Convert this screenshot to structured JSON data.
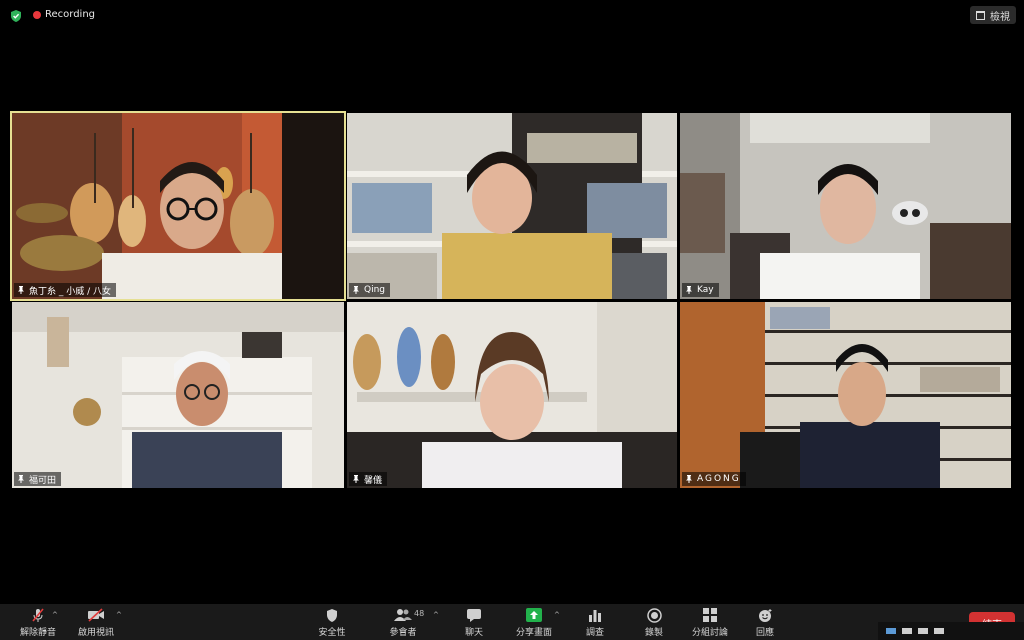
{
  "topbar": {
    "recording_label": "Recording",
    "view_label": "檢視"
  },
  "participants": [
    {
      "name": "魚丁糸 _ 小威 / 八女",
      "active": true
    },
    {
      "name": "Qing"
    },
    {
      "name": "Kay"
    },
    {
      "name": "福可田"
    },
    {
      "name": "馨儀"
    },
    {
      "name": "AGONG"
    }
  ],
  "toolbar": {
    "unmute_label": "解除靜音",
    "start_video_label": "啟用視訊",
    "security_label": "安全性",
    "participants_label": "參會者",
    "participants_count": "48",
    "chat_label": "聊天",
    "share_label": "分享畫面",
    "polls_label": "調查",
    "record_label": "錄製",
    "breakout_label": "分組討論",
    "reactions_label": "回應",
    "end_label": "結束"
  },
  "colors": {
    "active_speaker": "#e6e093",
    "share_green": "#22b24c",
    "end_red": "#d23232",
    "recording_red": "#e8383d"
  }
}
